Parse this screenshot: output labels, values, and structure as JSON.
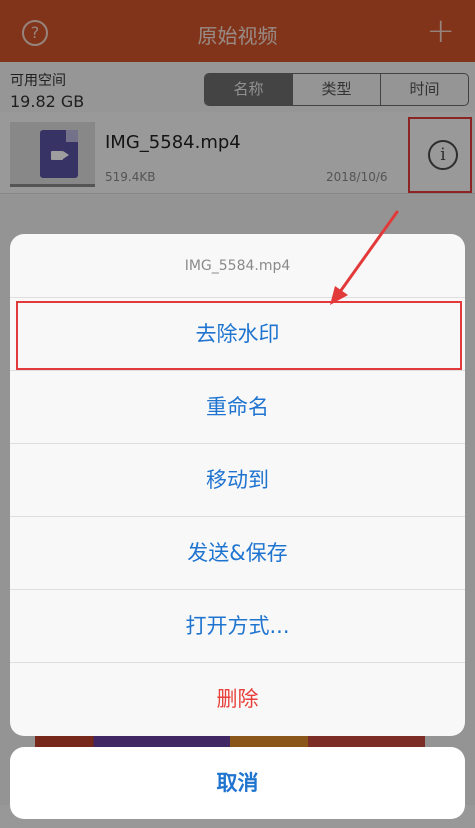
{
  "navbar": {
    "title": "原始视频",
    "help_icon": "question-circle-icon",
    "add_icon": "plus-icon",
    "help_glyph": "?",
    "add_glyph": "+"
  },
  "storage": {
    "label": "可用空间",
    "value": "19.82 GB"
  },
  "sort_tabs": [
    {
      "label": "名称",
      "active": true
    },
    {
      "label": "类型",
      "active": false
    },
    {
      "label": "时间",
      "active": false
    }
  ],
  "file": {
    "name": "IMG_5584.mp4",
    "size": "519.4KB",
    "date": "2018/10/6",
    "thumb_icon": "video-file-icon",
    "info_icon": "info-circle-icon",
    "info_glyph": "i"
  },
  "action_sheet": {
    "title": "IMG_5584.mp4",
    "items": [
      {
        "label": "去除水印"
      },
      {
        "label": "重命名"
      },
      {
        "label": "移动到"
      },
      {
        "label": "发送&保存"
      },
      {
        "label": "打开方式..."
      },
      {
        "label": "删除"
      }
    ],
    "cancel_label": "取消"
  },
  "colors": {
    "nav_bar": "#d2552b",
    "action_text": "#1f74d0",
    "destructive_text": "#e8403a",
    "annotation_red": "#e23a3a"
  }
}
